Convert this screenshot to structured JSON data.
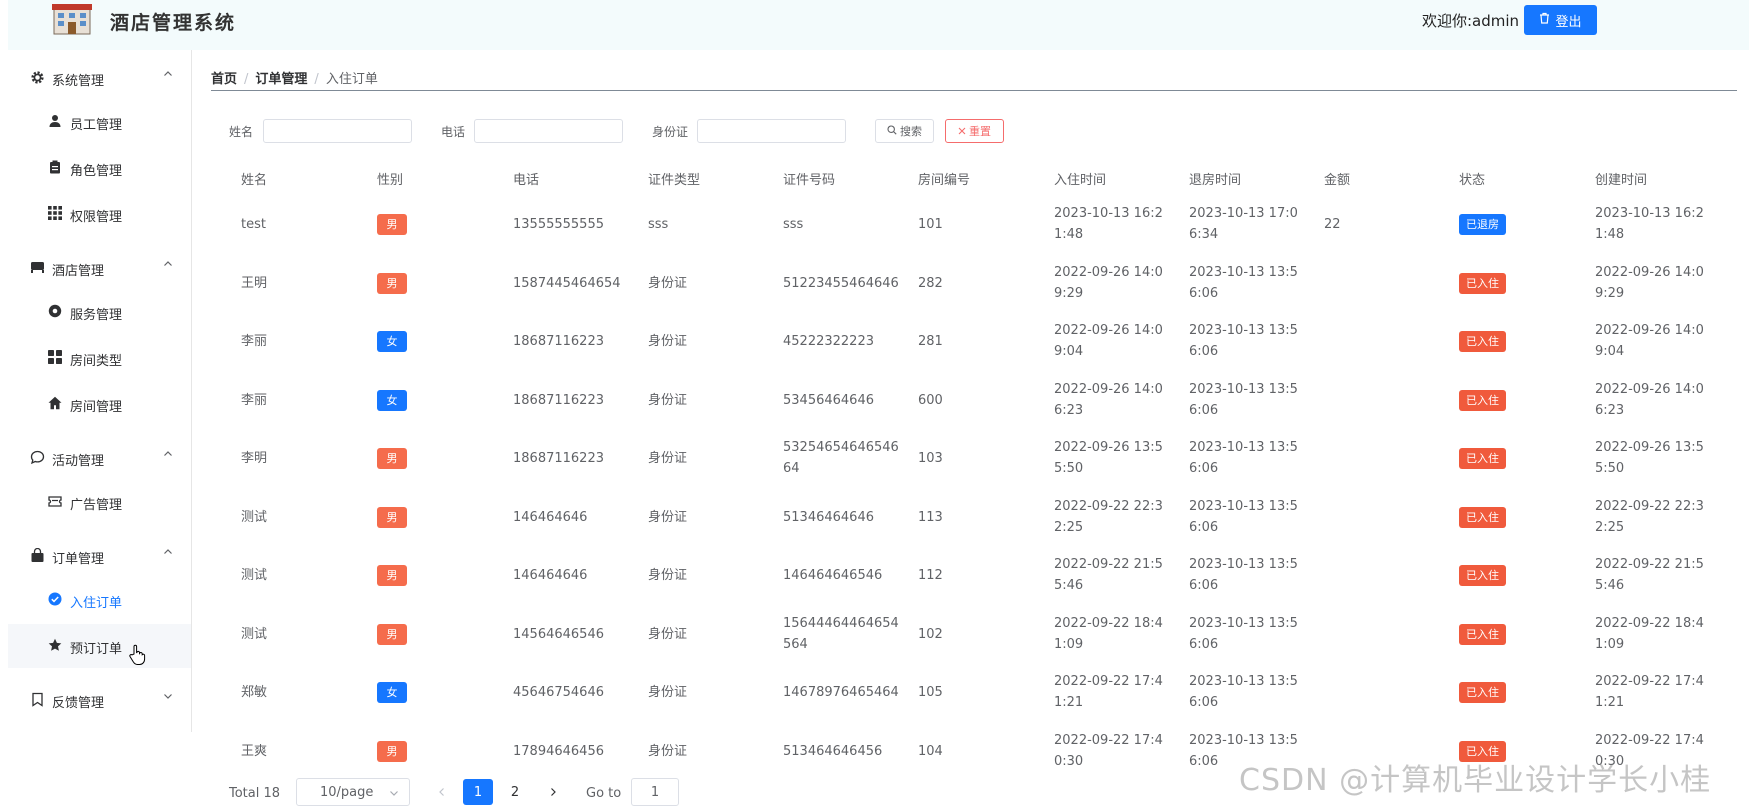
{
  "header": {
    "app_title": "酒店管理系统",
    "welcome": "欢迎你:admin",
    "logout_label": "登出"
  },
  "sidebar": {
    "groups": [
      {
        "label": "系统管理",
        "icon": "gear-icon",
        "expanded": true
      },
      {
        "label": "酒店管理",
        "icon": "hotel-icon",
        "expanded": true
      },
      {
        "label": "活动管理",
        "icon": "chat-bubble-icon",
        "expanded": true
      },
      {
        "label": "订单管理",
        "icon": "shopping-bag-icon",
        "expanded": true
      },
      {
        "label": "反馈管理",
        "icon": "bookmark-icon",
        "expanded": false
      }
    ],
    "items": [
      {
        "label": "员工管理",
        "icon": "user-icon"
      },
      {
        "label": "角色管理",
        "icon": "clipboard-icon"
      },
      {
        "label": "权限管理",
        "icon": "grid-icon"
      },
      {
        "label": "服务管理",
        "icon": "service-icon"
      },
      {
        "label": "房间类型",
        "icon": "apps-icon"
      },
      {
        "label": "房间管理",
        "icon": "home-icon"
      },
      {
        "label": "广告管理",
        "icon": "ticket-icon"
      },
      {
        "label": "入住订单",
        "icon": "check-circle-icon",
        "active": true
      },
      {
        "label": "预订订单",
        "icon": "star-icon"
      }
    ]
  },
  "breadcrumb": {
    "home": "首页",
    "section": "订单管理",
    "current": "入住订单"
  },
  "search": {
    "name_label": "姓名",
    "phone_label": "电话",
    "idcard_label": "身份证",
    "search_button": "搜索",
    "reset_button": "重置"
  },
  "table": {
    "columns": [
      "姓名",
      "性别",
      "电话",
      "证件类型",
      "证件号码",
      "房间编号",
      "入住时间",
      "退房时间",
      "金额",
      "状态",
      "创建时间"
    ],
    "rows": [
      {
        "name": "test",
        "gender": "男",
        "phone": "13555555555",
        "id_type": "sss",
        "id_no": [
          "sss"
        ],
        "room": "101",
        "checkin": [
          "2023-10-13 16:2",
          "1:48"
        ],
        "checkout": [
          "2023-10-13 17:0",
          "6:34"
        ],
        "amount": "22",
        "status": "已退房",
        "created": [
          "2023-10-13 16:2",
          "1:48"
        ]
      },
      {
        "name": "王明",
        "gender": "男",
        "phone": "1587445464654",
        "id_type": "身份证",
        "id_no": [
          "51223455464646"
        ],
        "room": "282",
        "checkin": [
          "2022-09-26 14:0",
          "9:29"
        ],
        "checkout": [
          "2023-10-13 13:5",
          "6:06"
        ],
        "amount": "",
        "status": "已入住",
        "created": [
          "2022-09-26 14:0",
          "9:29"
        ]
      },
      {
        "name": "李丽",
        "gender": "女",
        "phone": "18687116223",
        "id_type": "身份证",
        "id_no": [
          "45222322223"
        ],
        "room": "281",
        "checkin": [
          "2022-09-26 14:0",
          "9:04"
        ],
        "checkout": [
          "2023-10-13 13:5",
          "6:06"
        ],
        "amount": "",
        "status": "已入住",
        "created": [
          "2022-09-26 14:0",
          "9:04"
        ]
      },
      {
        "name": "李丽",
        "gender": "女",
        "phone": "18687116223",
        "id_type": "身份证",
        "id_no": [
          "53456464646"
        ],
        "room": "600",
        "checkin": [
          "2022-09-26 14:0",
          "6:23"
        ],
        "checkout": [
          "2023-10-13 13:5",
          "6:06"
        ],
        "amount": "",
        "status": "已入住",
        "created": [
          "2022-09-26 14:0",
          "6:23"
        ]
      },
      {
        "name": "李明",
        "gender": "男",
        "phone": "18687116223",
        "id_type": "身份证",
        "id_no": [
          "53254654646546",
          "64"
        ],
        "room": "103",
        "checkin": [
          "2022-09-26 13:5",
          "5:50"
        ],
        "checkout": [
          "2023-10-13 13:5",
          "6:06"
        ],
        "amount": "",
        "status": "已入住",
        "created": [
          "2022-09-26 13:5",
          "5:50"
        ]
      },
      {
        "name": "测试",
        "gender": "男",
        "phone": "146464646",
        "id_type": "身份证",
        "id_no": [
          "51346464646"
        ],
        "room": "113",
        "checkin": [
          "2022-09-22 22:3",
          "2:25"
        ],
        "checkout": [
          "2023-10-13 13:5",
          "6:06"
        ],
        "amount": "",
        "status": "已入住",
        "created": [
          "2022-09-22 22:3",
          "2:25"
        ]
      },
      {
        "name": "测试",
        "gender": "男",
        "phone": "146464646",
        "id_type": "身份证",
        "id_no": [
          "146464646546"
        ],
        "room": "112",
        "checkin": [
          "2022-09-22 21:5",
          "5:46"
        ],
        "checkout": [
          "2023-10-13 13:5",
          "6:06"
        ],
        "amount": "",
        "status": "已入住",
        "created": [
          "2022-09-22 21:5",
          "5:46"
        ]
      },
      {
        "name": "测试",
        "gender": "男",
        "phone": "14564646546",
        "id_type": "身份证",
        "id_no": [
          "15644464464654",
          "564"
        ],
        "room": "102",
        "checkin": [
          "2022-09-22 18:4",
          "1:09"
        ],
        "checkout": [
          "2023-10-13 13:5",
          "6:06"
        ],
        "amount": "",
        "status": "已入住",
        "created": [
          "2022-09-22 18:4",
          "1:09"
        ]
      },
      {
        "name": "郑敏",
        "gender": "女",
        "phone": "45646754646",
        "id_type": "身份证",
        "id_no": [
          "14678976465464"
        ],
        "room": "105",
        "checkin": [
          "2022-09-22 17:4",
          "1:21"
        ],
        "checkout": [
          "2023-10-13 13:5",
          "6:06"
        ],
        "amount": "",
        "status": "已入住",
        "created": [
          "2022-09-22 17:4",
          "1:21"
        ]
      },
      {
        "name": "王爽",
        "gender": "男",
        "phone": "17894646456",
        "id_type": "身份证",
        "id_no": [
          "513464646456"
        ],
        "room": "104",
        "checkin": [
          "2022-09-22 17:4",
          "0:30"
        ],
        "checkout": [
          "2023-10-13 13:5",
          "6:06"
        ],
        "amount": "",
        "status": "已入住",
        "created": [
          "2022-09-22 17:4",
          "0:30"
        ]
      }
    ]
  },
  "pagination": {
    "total": "Total 18",
    "page_size": "10/page",
    "pages": [
      "1",
      "2"
    ],
    "current_page": "1",
    "goto_label": "Go to",
    "goto_value": "1"
  },
  "colors": {
    "primary": "#1677ff",
    "male": "#f56c4c",
    "female": "#1677ff",
    "checked_in": "#f05a3c",
    "checked_out": "#1677ff"
  },
  "watermark": "CSDN @计算机毕业设计学长小桂"
}
